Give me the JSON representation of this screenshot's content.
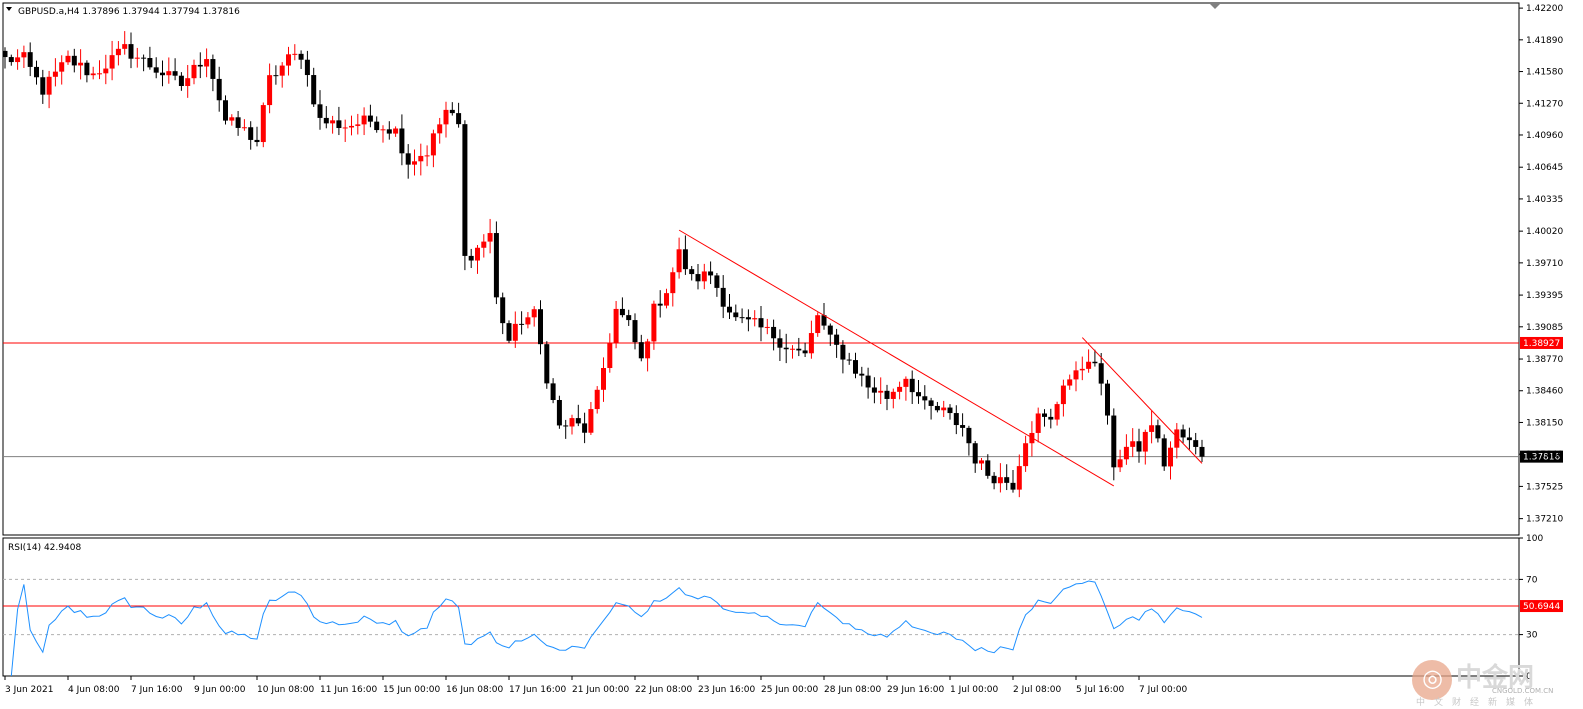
{
  "chart_data": [
    {
      "type": "candlestick",
      "symbol_header": "GBPUSD.a,H4  1.37896 1.37944 1.37794 1.37816",
      "ylim": [
        1.3705,
        1.4225
      ],
      "price_ticks": [
        "1.42200",
        "1.41890",
        "1.41580",
        "1.41270",
        "1.40960",
        "1.40645",
        "1.40335",
        "1.40020",
        "1.39710",
        "1.39395",
        "1.39085",
        "1.38770",
        "1.38460",
        "1.38150",
        "1.37840",
        "1.37525",
        "1.37210"
      ],
      "horizontal_line": {
        "value": 1.38927,
        "label": "1.38927",
        "color": "#ff0000"
      },
      "current_price": {
        "value": 1.37816,
        "label": "1.37816"
      },
      "trendlines": [
        {
          "from": {
            "bar": 107,
            "price": 1.4003
          },
          "to": {
            "bar": 176,
            "price": 1.3753
          },
          "color": "#ff0000"
        },
        {
          "from": {
            "bar": 171,
            "price": 1.3898
          },
          "to": {
            "bar": 190,
            "price": 1.3775
          },
          "color": "#ff0000"
        }
      ],
      "x_labels": [
        {
          "bar": 0,
          "label": "3 Jun 2021"
        },
        {
          "bar": 10,
          "label": "4 Jun 08:00"
        },
        {
          "bar": 20,
          "label": "7 Jun 16:00"
        },
        {
          "bar": 30,
          "label": "9 Jun 00:00"
        },
        {
          "bar": 40,
          "label": "10 Jun 08:00"
        },
        {
          "bar": 50,
          "label": "11 Jun 16:00"
        },
        {
          "bar": 60,
          "label": "15 Jun 00:00"
        },
        {
          "bar": 70,
          "label": "16 Jun 08:00"
        },
        {
          "bar": 80,
          "label": "17 Jun 16:00"
        },
        {
          "bar": 90,
          "label": "21 Jun 00:00"
        },
        {
          "bar": 100,
          "label": "22 Jun 08:00"
        },
        {
          "bar": 110,
          "label": "23 Jun 16:00"
        },
        {
          "bar": 120,
          "label": "25 Jun 00:00"
        },
        {
          "bar": 130,
          "label": "28 Jun 08:00"
        },
        {
          "bar": 140,
          "label": "29 Jun 16:00"
        },
        {
          "bar": 150,
          "label": "1 Jul 00:00"
        },
        {
          "bar": 160,
          "label": "2 Jul 08:00"
        },
        {
          "bar": 170,
          "label": "5 Jul 16:00"
        },
        {
          "bar": 180,
          "label": "7 Jul 00:00"
        }
      ],
      "close_anchors": [
        [
          0,
          1.417
        ],
        [
          3,
          1.417
        ],
        [
          6,
          1.414
        ],
        [
          10,
          1.417
        ],
        [
          14,
          1.4155
        ],
        [
          19,
          1.418
        ],
        [
          24,
          1.416
        ],
        [
          28,
          1.4145
        ],
        [
          32,
          1.4175
        ],
        [
          35,
          1.411
        ],
        [
          38,
          1.41
        ],
        [
          40,
          1.409
        ],
        [
          42,
          1.415
        ],
        [
          45,
          1.417
        ],
        [
          47,
          1.4175
        ],
        [
          50,
          1.411
        ],
        [
          54,
          1.4105
        ],
        [
          58,
          1.411
        ],
        [
          62,
          1.41
        ],
        [
          64,
          1.407
        ],
        [
          67,
          1.408
        ],
        [
          70,
          1.412
        ],
        [
          72,
          1.4105
        ],
        [
          73,
          1.3975
        ],
        [
          75,
          1.3985
        ],
        [
          77,
          1.4
        ],
        [
          78,
          1.3935
        ],
        [
          80,
          1.3895
        ],
        [
          82,
          1.3915
        ],
        [
          84,
          1.392
        ],
        [
          86,
          1.386
        ],
        [
          88,
          1.381
        ],
        [
          90,
          1.3815
        ],
        [
          92,
          1.3808
        ],
        [
          94,
          1.384
        ],
        [
          97,
          1.3925
        ],
        [
          99,
          1.391
        ],
        [
          101,
          1.3875
        ],
        [
          103,
          1.3925
        ],
        [
          105,
          1.3945
        ],
        [
          107,
          1.398
        ],
        [
          109,
          1.3955
        ],
        [
          112,
          1.396
        ],
        [
          114,
          1.3935
        ],
        [
          116,
          1.3915
        ],
        [
          119,
          1.391
        ],
        [
          122,
          1.39
        ],
        [
          124,
          1.389
        ],
        [
          127,
          1.388
        ],
        [
          129,
          1.392
        ],
        [
          131,
          1.3895
        ],
        [
          134,
          1.3875
        ],
        [
          137,
          1.385
        ],
        [
          140,
          1.384
        ],
        [
          143,
          1.386
        ],
        [
          146,
          1.383
        ],
        [
          149,
          1.3825
        ],
        [
          152,
          1.381
        ],
        [
          154,
          1.378
        ],
        [
          156,
          1.3765
        ],
        [
          158,
          1.376
        ],
        [
          160,
          1.3755
        ],
        [
          162,
          1.38
        ],
        [
          164,
          1.382
        ],
        [
          166,
          1.3815
        ],
        [
          168,
          1.3855
        ],
        [
          170,
          1.386
        ],
        [
          172,
          1.388
        ],
        [
          174,
          1.3855
        ],
        [
          176,
          1.3775
        ],
        [
          178,
          1.379
        ],
        [
          180,
          1.379
        ],
        [
          182,
          1.3815
        ],
        [
          184,
          1.3775
        ],
        [
          186,
          1.3805
        ],
        [
          188,
          1.3795
        ],
        [
          190,
          1.3782
        ]
      ],
      "bar_count": 191
    },
    {
      "type": "line",
      "title": "RSI(14) 42.9408",
      "ylim": [
        0,
        100
      ],
      "ticks": [
        "100",
        "70",
        "30",
        "0"
      ],
      "level_line": {
        "value": 50.6944,
        "label": "50.6944",
        "color": "#ff0000"
      },
      "series_color": "#1e90ff",
      "derived_from": "close values of first chart"
    }
  ],
  "watermark": {
    "brand_cn": "中金网",
    "url": "CNGOLD.COM.CN",
    "sub_cn": "中文财经新媒体"
  }
}
